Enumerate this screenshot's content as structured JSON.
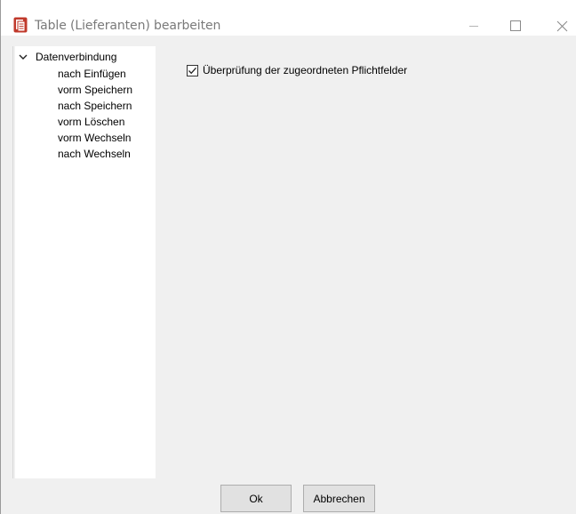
{
  "window": {
    "title": "Table (Lieferanten) bearbeiten",
    "app_icon": "document-stack-icon",
    "accent_color": "#c0392b"
  },
  "tree": {
    "root_label": "Datenverbindung",
    "expanded": true,
    "items": [
      {
        "label": "nach Einfügen"
      },
      {
        "label": "vorm Speichern"
      },
      {
        "label": "nach Speichern"
      },
      {
        "label": "vorm Löschen"
      },
      {
        "label": "vorm Wechseln"
      },
      {
        "label": "nach Wechseln"
      }
    ]
  },
  "options": {
    "check_required_fields": {
      "label": "Überprüfung der zugeordneten Pflichtfelder",
      "checked": true
    }
  },
  "buttons": {
    "ok_label": "Ok",
    "cancel_label": "Abbrechen"
  }
}
